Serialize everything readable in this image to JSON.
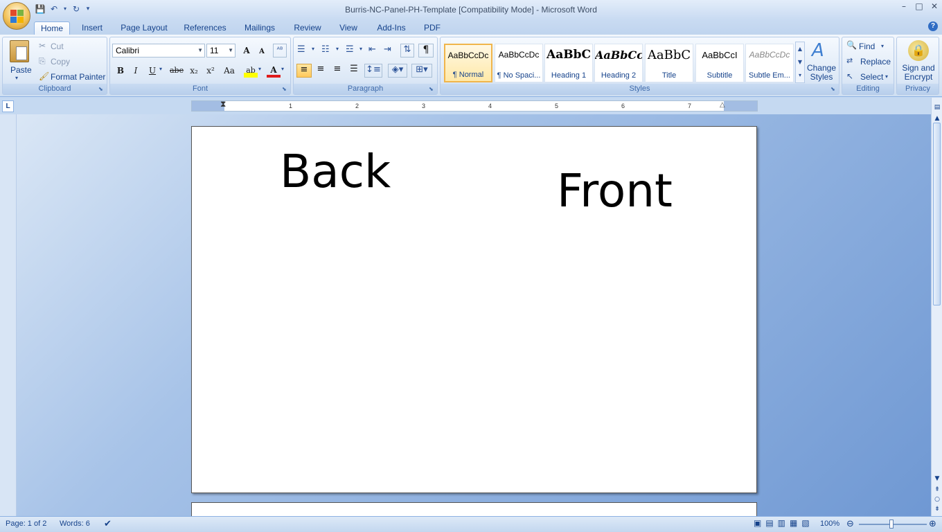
{
  "window": {
    "title": "Burris-NC-Panel-PH-Template [Compatibility Mode] - Microsoft Word",
    "minimize_icon": "minimize-icon",
    "maximize_icon": "restore-icon",
    "close_icon": "close-icon"
  },
  "quick_access": [
    "save-icon",
    "undo-icon",
    "redo-icon",
    "customize-icon"
  ],
  "tabs": [
    {
      "label": "Home",
      "active": true
    },
    {
      "label": "Insert"
    },
    {
      "label": "Page Layout"
    },
    {
      "label": "References"
    },
    {
      "label": "Mailings"
    },
    {
      "label": "Review"
    },
    {
      "label": "View"
    },
    {
      "label": "Add-Ins"
    },
    {
      "label": "PDF"
    }
  ],
  "ribbon": {
    "clipboard": {
      "label": "Clipboard",
      "paste": "Paste",
      "cut": "Cut",
      "copy": "Copy",
      "format_painter": "Format Painter"
    },
    "font": {
      "label": "Font",
      "font_name": "Calibri",
      "font_size": "11",
      "bold": "B",
      "italic": "I",
      "underline": "U",
      "strikethrough": "abe",
      "subscript": "x₂",
      "superscript": "x²",
      "change_case": "Aa",
      "grow": "A",
      "shrink": "A",
      "highlight": "ab",
      "font_color": "A"
    },
    "paragraph": {
      "label": "Paragraph",
      "show_marks": "¶"
    },
    "styles": {
      "label": "Styles",
      "items": [
        {
          "sample": "AaBbCcDc",
          "name": "¶ Normal",
          "selected": true
        },
        {
          "sample": "AaBbCcDc",
          "name": "¶ No Spaci..."
        },
        {
          "sample": "AaBbC",
          "name": "Heading 1"
        },
        {
          "sample": "AaBbCc",
          "name": "Heading 2"
        },
        {
          "sample": "AaBbC",
          "name": "Title"
        },
        {
          "sample": "AaBbCcI",
          "name": "Subtitle"
        },
        {
          "sample": "AaBbCcDc",
          "name": "Subtle Em..."
        }
      ],
      "change_styles": "Change Styles"
    },
    "editing": {
      "label": "Editing",
      "find": "Find",
      "replace": "Replace",
      "select": "Select"
    },
    "privacy": {
      "label": "Privacy",
      "sign_encrypt": "Sign and Encrypt"
    }
  },
  "ruler": {
    "numbers": [
      "1",
      "2",
      "3",
      "4",
      "5",
      "6",
      "7"
    ],
    "tab_selector": "L"
  },
  "document": {
    "text_back": "Back",
    "text_front": "Front"
  },
  "status": {
    "page": "Page: 1 of 2",
    "words": "Words: 6",
    "zoom": "100%"
  },
  "colors": {
    "accent": "#15428b",
    "ribbon_bg": "#dfe9f6",
    "selected_style": "#f0b54b",
    "workspace": "#6f98d3"
  }
}
